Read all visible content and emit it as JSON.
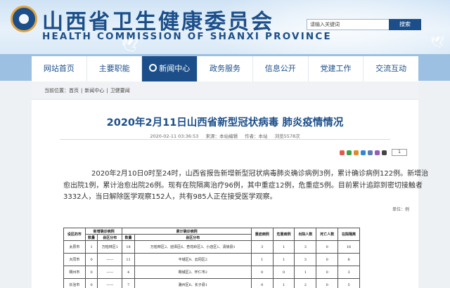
{
  "header": {
    "title_zh": "山西省卫生健康委员会",
    "title_en": "HEALTH COMMISSION OF SHANXI PROVINCE",
    "search_placeholder": "请输入关键词",
    "search_button": "搜索"
  },
  "nav": {
    "items": [
      {
        "label": "网站首页"
      },
      {
        "label": "主要职能"
      },
      {
        "label": "新闻中心",
        "active": true
      },
      {
        "label": "政务服务"
      },
      {
        "label": "信息公开"
      },
      {
        "label": "党建工作"
      },
      {
        "label": "交流互动"
      }
    ]
  },
  "breadcrumb": {
    "prefix": "当前位置：",
    "items": [
      "首页",
      "新闻中心",
      "卫健要闻"
    ]
  },
  "article": {
    "title": "2020年2月11日山西省新型冠状病毒 肺炎疫情情况",
    "date": "2020-02-11 03:36:53",
    "source": "来源：本站编辑",
    "author": "作者：本站",
    "views": "浏览5578次",
    "page_box": "1",
    "body": "2020年2月10日0时至24时，山西省报告新增新型冠状病毒肺炎确诊病例3例，累计确诊病例122例。新增治愈出院1例，累计治愈出院26例。现有在院隔离治疗96例，其中重症12例，危重症5例。目前累计追踪到密切接触者3332人，当日解除医学观察152人，共有985人正在接受医学观察。",
    "unit": "单位：例"
  },
  "table": {
    "h_region": "设区的市",
    "h_new": "新增确诊病例",
    "h_total": "累计确诊病例",
    "h_severe": "重症病例",
    "h_critical": "危重病例",
    "h_cured": "出院人数",
    "h_death": "死亡人数",
    "h_iso": "在院隔离",
    "sub_count": "数量",
    "sub_dist": "县区分布",
    "rows": [
      {
        "city": "太原市",
        "new": "1",
        "new_dist": "万柏林区1",
        "total": "18",
        "total_dist": "万柏林区2、迎泽区6、杏花岭区3、小店区1、清徐县1",
        "severe": "3",
        "critical": "1",
        "cured": "3",
        "death": "0",
        "iso": "16"
      },
      {
        "city": "大同市",
        "new": "0",
        "new_dist": "——",
        "total": "11",
        "total_dist": "平城区9、云冈区2",
        "severe": "1",
        "critical": "1",
        "cured": "3",
        "death": "0",
        "iso": "8"
      },
      {
        "city": "朔州市",
        "new": "0",
        "new_dist": "——",
        "total": "4",
        "total_dist": "朔城区2、怀仁市2",
        "severe": "0",
        "critical": "0",
        "cured": "1",
        "death": "0",
        "iso": "3"
      },
      {
        "city": "长治市",
        "new": "0",
        "new_dist": "——",
        "total": "7",
        "total_dist": "潞州区6、长子县1",
        "severe": "0",
        "critical": "1",
        "cured": "2",
        "death": "0",
        "iso": "5"
      }
    ]
  },
  "colors": {
    "brand": "#1c4f8a",
    "nav_band": "#9cc0e2"
  }
}
